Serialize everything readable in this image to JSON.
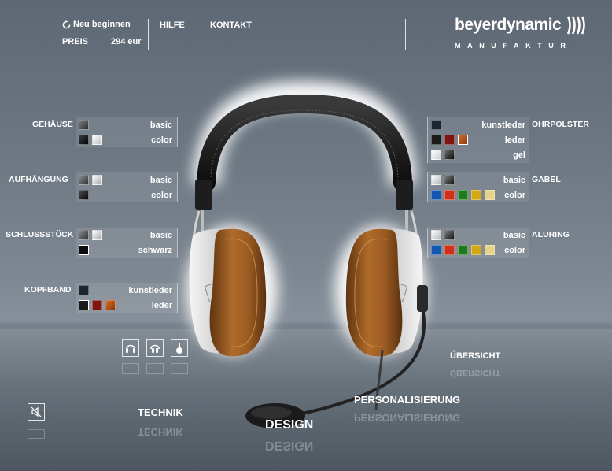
{
  "header": {
    "restart_label": "Neu beginnen",
    "price_label": "PREIS",
    "price_value": "294 eur",
    "nav_help": "HILFE",
    "nav_contact": "KONTAKT",
    "logo_text": "beyerdynamic",
    "logo_sub": "MANUFAKTUR"
  },
  "left_options": [
    {
      "label": "GEHÄUSE",
      "rows": [
        {
          "text": "basic",
          "swatches": [
            "#4b4d50"
          ]
        },
        {
          "text": "color",
          "swatches": [
            "#141414",
            "#f2f2f2"
          ]
        }
      ]
    },
    {
      "label": "AUFHÄNGUNG",
      "rows": [
        {
          "text": "basic",
          "swatches": [
            "#5a5c5f",
            "#dcdcdc"
          ]
        },
        {
          "text": "color",
          "swatches": [
            "#1b1b1b"
          ]
        }
      ]
    },
    {
      "label": "SCHLUSSSTÜCK",
      "rows": [
        {
          "text": "basic",
          "swatches": [
            "#55575a",
            "#d8d8d8"
          ]
        },
        {
          "text": "schwarz",
          "swatches": [
            "#0c0c0c"
          ]
        }
      ]
    },
    {
      "label": "KOPFBAND",
      "rows": [
        {
          "text": "kunstleder",
          "swatches": [
            "#1d2530"
          ]
        },
        {
          "text": "leder",
          "swatches": [
            "#1a1a1a",
            "#7e1512",
            "#b8511b"
          ]
        }
      ]
    }
  ],
  "right_options": [
    {
      "label": "OHRPOLSTER",
      "rows": [
        {
          "text": "kunstleder",
          "swatches": [
            "#1d2530"
          ]
        },
        {
          "text": "leder",
          "swatches": [
            "#1a1a1a",
            "#7e1512",
            "#b8511b"
          ]
        },
        {
          "text": "gel",
          "swatches": [
            "#f2f2f2",
            "#2b2b2b"
          ]
        }
      ]
    },
    {
      "label": "GABEL",
      "rows": [
        {
          "text": "basic",
          "swatches": [
            "#e0e0e0",
            "#3a3a3a"
          ]
        },
        {
          "text": "color",
          "swatches": [
            "#1557b0",
            "#d0301a",
            "#1f7a1c",
            "#d3a813",
            "#e6d48a"
          ]
        }
      ]
    },
    {
      "label": "ALURING",
      "rows": [
        {
          "text": "basic",
          "swatches": [
            "#e0e0e0",
            "#3a3a3a"
          ]
        },
        {
          "text": "color",
          "swatches": [
            "#1557b0",
            "#d0301a",
            "#1f7a1c",
            "#d3a813",
            "#e6d48a"
          ]
        }
      ]
    }
  ],
  "bottom_nav": {
    "technik": "TECHNIK",
    "design": "DESIGN",
    "personalisierung": "PERSONALISIERUNG",
    "uebersicht": "ÜBERSICHT"
  },
  "view_icons": [
    "headphones-front-icon",
    "headphones-back-icon",
    "headphones-side-icon"
  ],
  "mute_icon": "speaker-mute-icon"
}
